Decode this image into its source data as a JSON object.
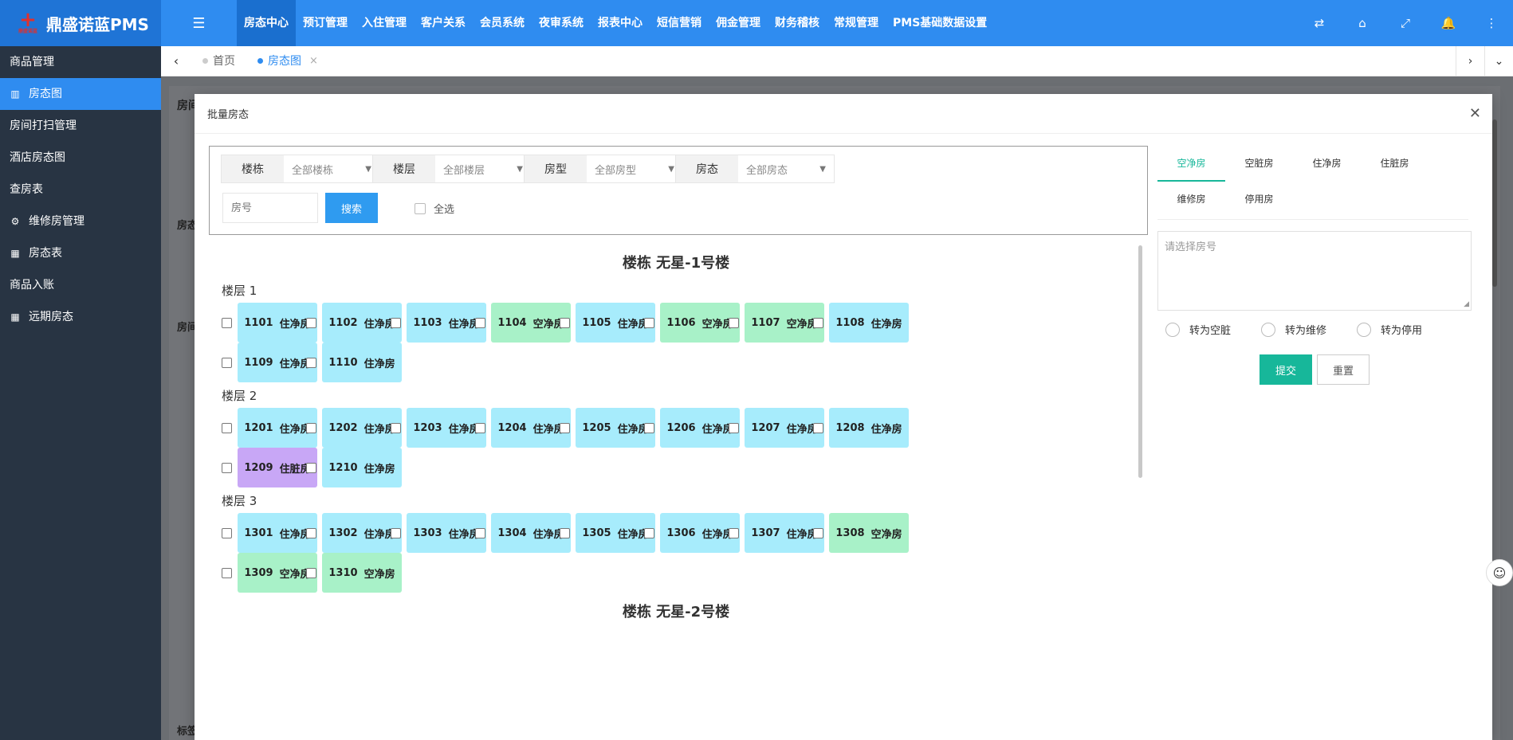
{
  "brand": {
    "name": "鼎盛诺蓝PMS",
    "logo_sub": "鼎盛诺蓝"
  },
  "topnav": {
    "items": [
      "房态中心",
      "预订管理",
      "入住管理",
      "客户关系",
      "会员系统",
      "夜审系统",
      "报表中心",
      "短信营销",
      "佣金管理",
      "财务稽核",
      "常规管理",
      "PMS基础数据设置"
    ],
    "active": "房态中心"
  },
  "sidebar": {
    "items": [
      {
        "label": "商品管理",
        "icon": ""
      },
      {
        "label": "房态图",
        "icon": "building-icon",
        "active": true
      },
      {
        "label": "房间打扫管理",
        "icon": ""
      },
      {
        "label": "酒店房态图",
        "icon": ""
      },
      {
        "label": "查房表",
        "icon": ""
      },
      {
        "label": "维修房管理",
        "icon": "gears-icon"
      },
      {
        "label": "房态表",
        "icon": "grid-icon"
      },
      {
        "label": "商品入账",
        "icon": ""
      },
      {
        "label": "远期房态",
        "icon": "grid-icon"
      }
    ]
  },
  "tabs": {
    "home": "首页",
    "current": "房态图"
  },
  "modal": {
    "title": "批量房态",
    "filters": [
      {
        "label": "楼栋",
        "value": "全部楼栋"
      },
      {
        "label": "楼层",
        "value": "全部楼层"
      },
      {
        "label": "房型",
        "value": "全部房型"
      },
      {
        "label": "房态",
        "value": "全部房态"
      }
    ],
    "room_placeholder": "房号",
    "search_label": "搜索",
    "select_all_label": "全选",
    "buildings": [
      {
        "title": "楼栋 无星-1号楼",
        "floors": [
          {
            "label": "楼层 1",
            "rooms": [
              {
                "no": "1101",
                "status": "住净房",
                "type": "occ"
              },
              {
                "no": "1102",
                "status": "住净房",
                "type": "occ"
              },
              {
                "no": "1103",
                "status": "住净房",
                "type": "occ"
              },
              {
                "no": "1104",
                "status": "空净房",
                "type": "vac"
              },
              {
                "no": "1105",
                "status": "住净房",
                "type": "occ"
              },
              {
                "no": "1106",
                "status": "空净房",
                "type": "vac"
              },
              {
                "no": "1107",
                "status": "空净房",
                "type": "vac"
              },
              {
                "no": "1108",
                "status": "住净房",
                "type": "occ"
              },
              {
                "no": "1109",
                "status": "住净房",
                "type": "occ"
              },
              {
                "no": "1110",
                "status": "住净房",
                "type": "occ"
              }
            ]
          },
          {
            "label": "楼层 2",
            "rooms": [
              {
                "no": "1201",
                "status": "住净房",
                "type": "occ"
              },
              {
                "no": "1202",
                "status": "住净房",
                "type": "occ"
              },
              {
                "no": "1203",
                "status": "住净房",
                "type": "occ"
              },
              {
                "no": "1204",
                "status": "住净房",
                "type": "occ"
              },
              {
                "no": "1205",
                "status": "住净房",
                "type": "occ"
              },
              {
                "no": "1206",
                "status": "住净房",
                "type": "occ"
              },
              {
                "no": "1207",
                "status": "住净房",
                "type": "occ"
              },
              {
                "no": "1208",
                "status": "住净房",
                "type": "occ"
              },
              {
                "no": "1209",
                "status": "住脏房",
                "type": "dirty"
              },
              {
                "no": "1210",
                "status": "住净房",
                "type": "occ"
              }
            ]
          },
          {
            "label": "楼层 3",
            "rooms": [
              {
                "no": "1301",
                "status": "住净房",
                "type": "occ"
              },
              {
                "no": "1302",
                "status": "住净房",
                "type": "occ"
              },
              {
                "no": "1303",
                "status": "住净房",
                "type": "occ"
              },
              {
                "no": "1304",
                "status": "住净房",
                "type": "occ"
              },
              {
                "no": "1305",
                "status": "住净房",
                "type": "occ"
              },
              {
                "no": "1306",
                "status": "住净房",
                "type": "occ"
              },
              {
                "no": "1307",
                "status": "住净房",
                "type": "occ"
              },
              {
                "no": "1308",
                "status": "空净房",
                "type": "vac"
              },
              {
                "no": "1309",
                "status": "空净房",
                "type": "vac"
              },
              {
                "no": "1310",
                "status": "空净房",
                "type": "vac"
              }
            ]
          }
        ]
      },
      {
        "title": "楼栋 无星-2号楼",
        "floors": []
      }
    ],
    "status_tabs": [
      "空净房",
      "空脏房",
      "住净房",
      "住脏房",
      "维修房",
      "停用房"
    ],
    "status_tab_active": "空净房",
    "pick_placeholder": "请选择房号",
    "radios": [
      "转为空脏",
      "转为维修",
      "转为停用"
    ],
    "submit_label": "提交",
    "reset_label": "重置"
  },
  "background": {
    "page_title_fragment": "房间",
    "label1": "房态",
    "label2": "房间",
    "label3": "标签"
  },
  "colors": {
    "primary": "#2f8cf0",
    "teal": "#17b79a",
    "occupied_clean": "#a7ecfc",
    "vacant_clean": "#a8f1c8",
    "occupied_dirty": "#c8a7f6",
    "sidebar": "#283443"
  }
}
